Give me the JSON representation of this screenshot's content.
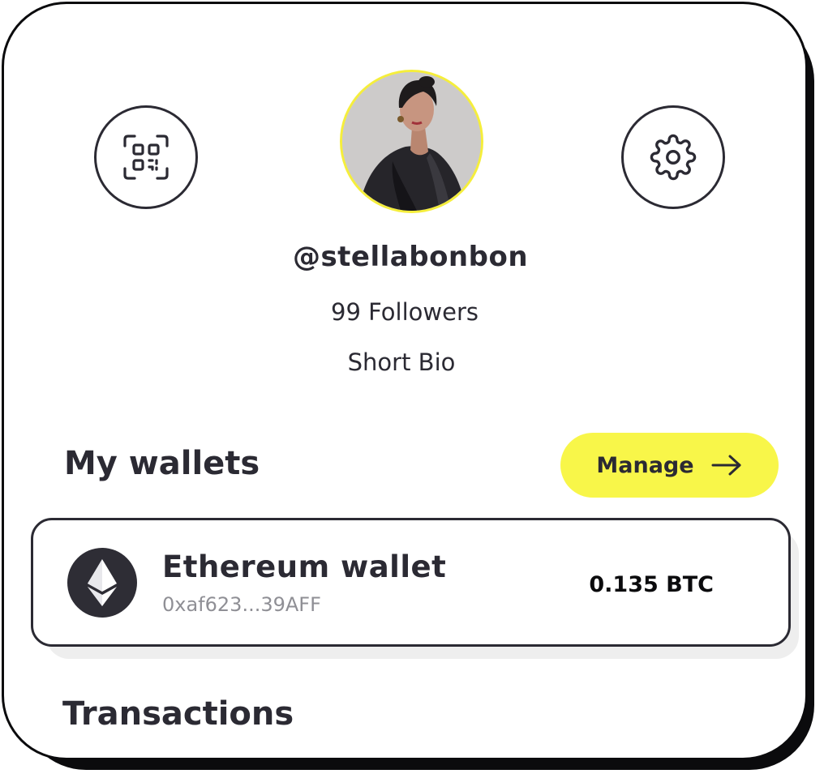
{
  "profile": {
    "handle": "@stellabonbon",
    "followers": "99 Followers",
    "bio": "Short Bio"
  },
  "actions": {
    "qr_icon": "qr-scan-icon",
    "settings_icon": "gear-icon"
  },
  "wallets": {
    "title": "My wallets",
    "manage_label": "Manage",
    "items": [
      {
        "name": "Ethereum wallet",
        "address": "0xaf623...39AFF",
        "balance": "0.135 BTC",
        "icon": "ethereum-icon"
      }
    ]
  },
  "transactions": {
    "title": "Transactions"
  },
  "colors": {
    "accent": "#f8f649",
    "avatar_ring": "#f5ee3c",
    "text": "#2b2a33",
    "muted": "#8f8f95"
  }
}
